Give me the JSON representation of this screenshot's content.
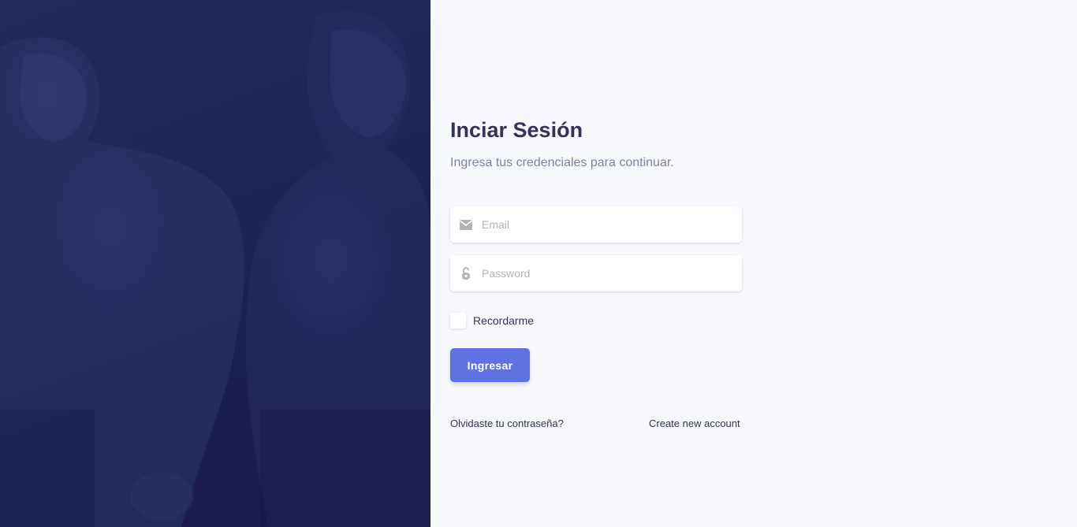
{
  "login": {
    "title": "Inciar Sesión",
    "subtitle": "Ingresa tus credenciales para continuar.",
    "email_placeholder": "Email",
    "password_placeholder": "Password",
    "remember_label": "Recordarme",
    "submit_label": "Ingresar",
    "forgot_link": "Olvidaste tu contraseña?",
    "create_link": "Create new account"
  },
  "icons": {
    "email": "envelope-icon",
    "password": "lock-open-icon"
  },
  "colors": {
    "accent": "#5e72e4",
    "title": "#32325d",
    "subtitle": "#7b83a3",
    "panel_bg": "#f7f8fd",
    "hero_overlay": "#1c2556"
  }
}
